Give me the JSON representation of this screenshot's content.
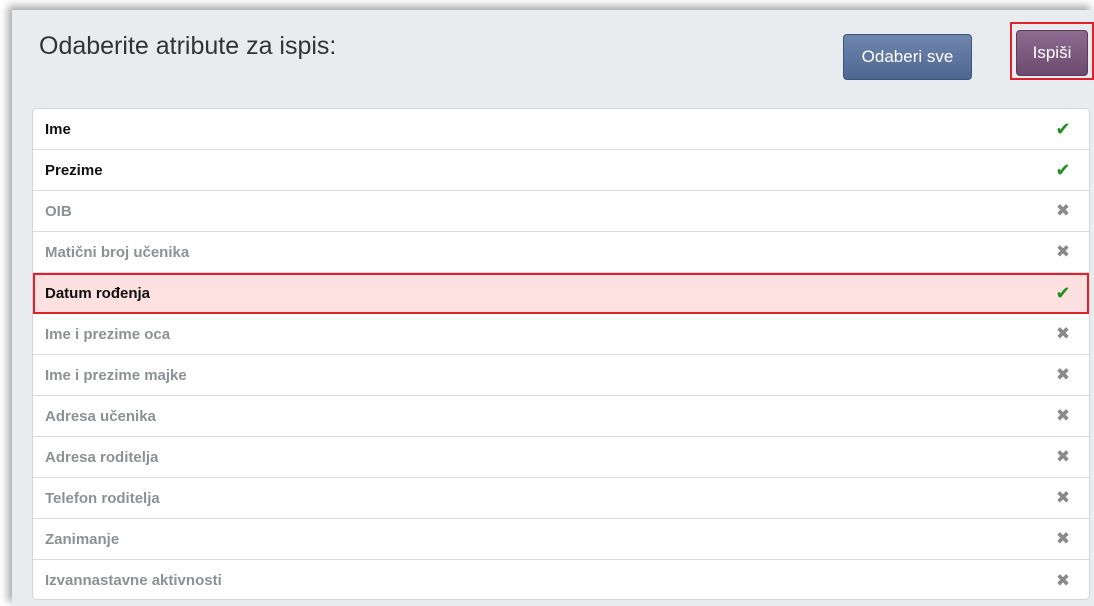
{
  "header": {
    "title": "Odaberite atribute za ispis:",
    "select_all_label": "Odaberi sve",
    "print_label": "Ispiši"
  },
  "attributes": [
    {
      "label": "Ime",
      "selected": true,
      "icon": "check-icon"
    },
    {
      "label": "Prezime",
      "selected": true,
      "icon": "check-icon"
    },
    {
      "label": "OIB",
      "selected": false,
      "icon": "cross-icon"
    },
    {
      "label": "Matični broj učenika",
      "selected": false,
      "icon": "cross-icon"
    },
    {
      "label": "Datum rođenja",
      "selected": true,
      "icon": "check-icon",
      "highlighted": true
    },
    {
      "label": "Ime i prezime oca",
      "selected": false,
      "icon": "cross-icon"
    },
    {
      "label": "Ime i prezime majke",
      "selected": false,
      "icon": "cross-icon"
    },
    {
      "label": "Adresa učenika",
      "selected": false,
      "icon": "cross-icon"
    },
    {
      "label": "Adresa roditelja",
      "selected": false,
      "icon": "cross-icon"
    },
    {
      "label": "Telefon roditelja",
      "selected": false,
      "icon": "cross-icon"
    },
    {
      "label": "Zanimanje",
      "selected": false,
      "icon": "cross-icon"
    },
    {
      "label": "Izvannastavne aktivnosti",
      "selected": false,
      "icon": "cross-icon"
    }
  ],
  "colors": {
    "panel_bg": "#e9ecef",
    "select_all_button": "#5b73a0",
    "print_button": "#7d5a80",
    "check": "#1f8f1f",
    "cross": "#8a8a8a",
    "highlight_border": "#e0202a",
    "highlight_fill": "#fde0e0"
  }
}
